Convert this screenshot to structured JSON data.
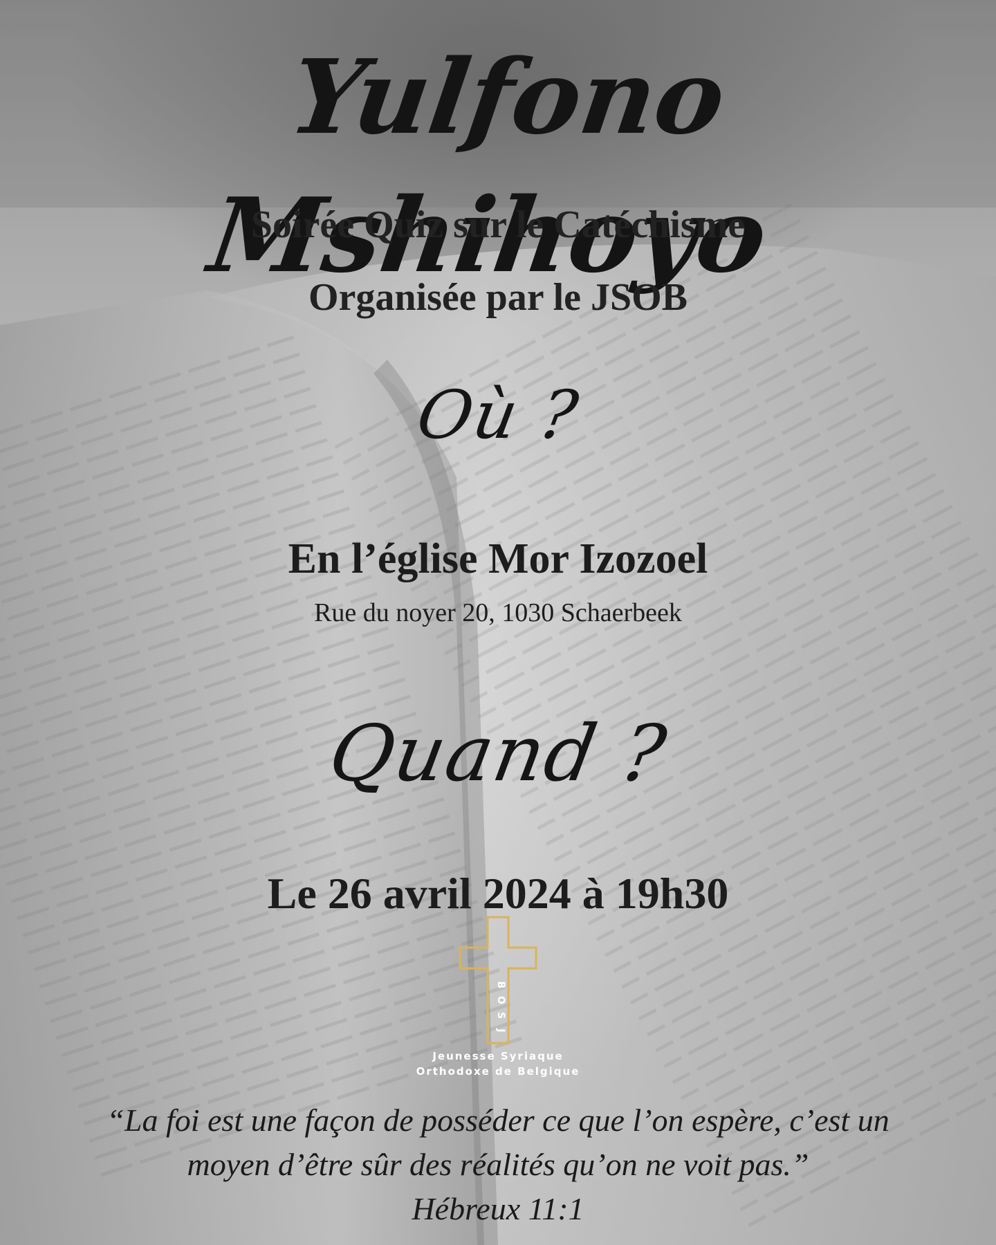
{
  "title": "Yulfono Mshihoyo",
  "subtitle": "Soirée Quiz sur le Catéchisme",
  "organizer": "Organisée par le JSOB",
  "where": {
    "heading": "Où ?",
    "venue": "En l’église Mor Izozoel",
    "address": "Rue du noyer 20, 1030 Schaerbeek"
  },
  "when": {
    "heading": "Quand ?",
    "date": "Le 26 avril 2024 à 19h30"
  },
  "logo": {
    "letters": "JSOB",
    "line1": "Jeunesse Syriaque",
    "line2": "Orthodoxe de Belgique",
    "color": "#d9b45a"
  },
  "quote": {
    "line1": "“La foi est une façon de posséder ce que l’on espère, c’est un",
    "line2": "moyen d’être sûr des réalités qu’on ne voit pas.”",
    "reference": "Hébreux 11:1"
  }
}
